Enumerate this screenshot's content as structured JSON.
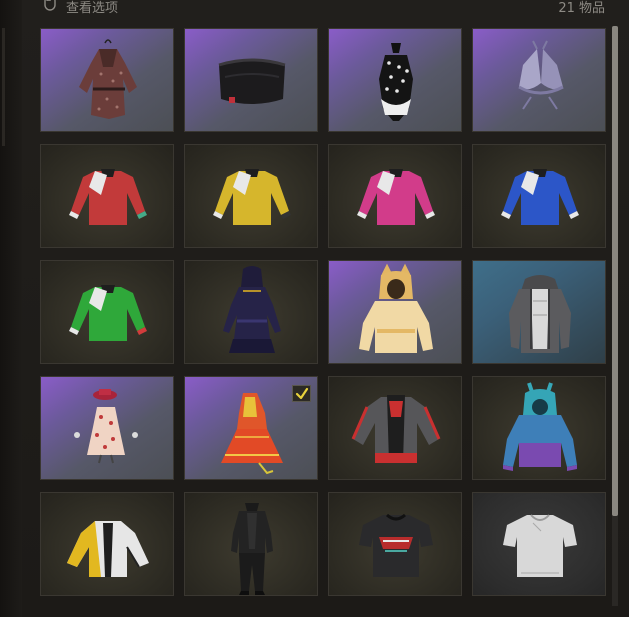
{
  "header": {
    "view_options_label": "查看选项",
    "item_count": "21 物品"
  },
  "icons": {
    "mouse": "mouse-icon",
    "equipped": "checkmark-icon"
  },
  "colors": {
    "equipped_check": "#e8d23c",
    "rarity_purple": "#8a5cc8",
    "rarity_blue": "#3f6f8a"
  },
  "items": [
    {
      "name": "patterned-wrap-dress",
      "rarity": "purple",
      "equipped": false
    },
    {
      "name": "black-tube-top",
      "rarity": "purple",
      "equipped": false
    },
    {
      "name": "polka-dot-swimsuit",
      "rarity": "purple",
      "equipped": false
    },
    {
      "name": "lavender-bikini-top",
      "rarity": "purple",
      "equipped": false
    },
    {
      "name": "red-long-sleeve-shirt",
      "rarity": "olive",
      "equipped": false
    },
    {
      "name": "yellow-long-sleeve-shirt",
      "rarity": "olive",
      "equipped": false
    },
    {
      "name": "pink-long-sleeve-shirt",
      "rarity": "olive",
      "equipped": false
    },
    {
      "name": "blue-long-sleeve-shirt",
      "rarity": "olive",
      "equipped": false
    },
    {
      "name": "green-long-sleeve-shirt",
      "rarity": "olive",
      "equipped": false
    },
    {
      "name": "dark-hooded-dress",
      "rarity": "olive",
      "equipped": false
    },
    {
      "name": "cat-ear-yellow-hoodie",
      "rarity": "purple",
      "equipped": false
    },
    {
      "name": "gray-hooded-jacket",
      "rarity": "blue",
      "equipped": false
    },
    {
      "name": "floral-dress-with-hat",
      "rarity": "purple",
      "equipped": false
    },
    {
      "name": "orange-festive-dress",
      "rarity": "purple",
      "equipped": true
    },
    {
      "name": "gray-red-track-jacket",
      "rarity": "olive",
      "equipped": false
    },
    {
      "name": "teal-purple-bunny-hoodie",
      "rarity": "olive",
      "equipped": false
    },
    {
      "name": "yellow-white-jacket",
      "rarity": "olive",
      "equipped": false
    },
    {
      "name": "black-leather-outfit",
      "rarity": "olive",
      "equipped": false
    },
    {
      "name": "black-graphic-tee",
      "rarity": "olive",
      "equipped": false
    },
    {
      "name": "white-t-shirt",
      "rarity": "gray",
      "equipped": false
    }
  ]
}
